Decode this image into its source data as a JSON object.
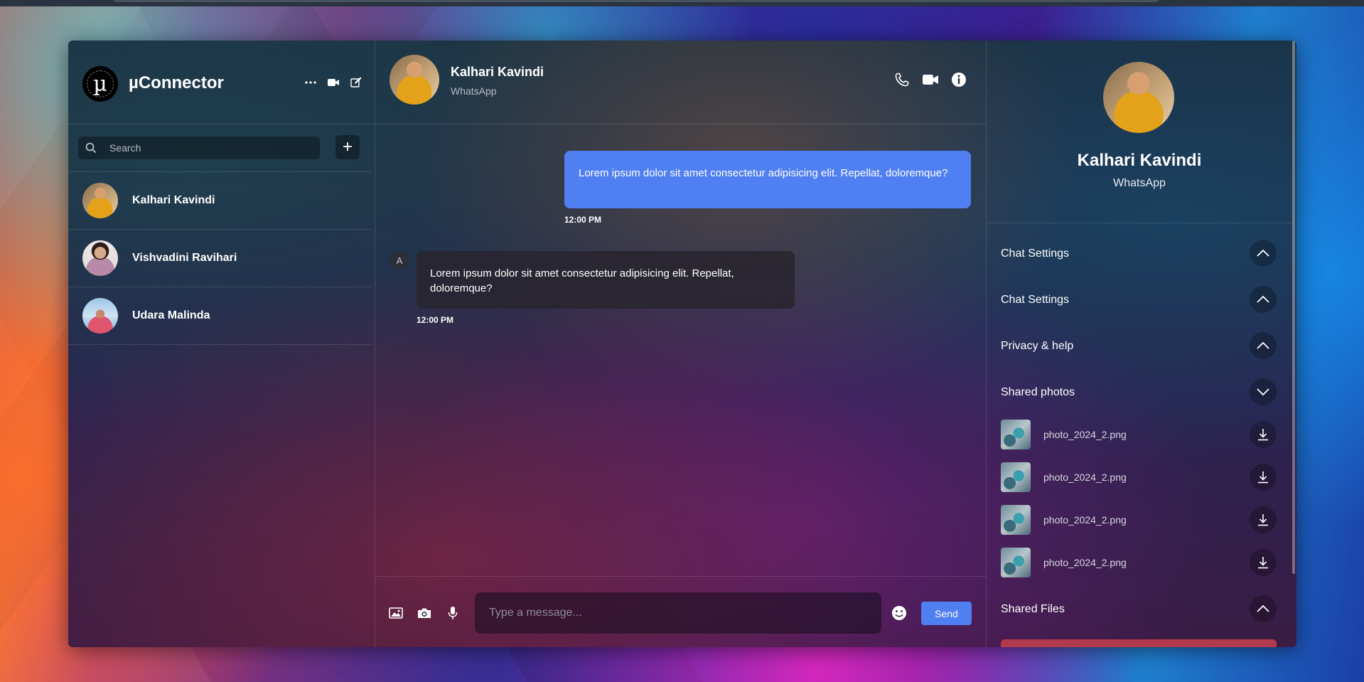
{
  "app": {
    "name": "µConnector",
    "logo_glyph": "µ"
  },
  "colors": {
    "accent": "#4f7ff0",
    "incoming_bubble": "#28242e"
  },
  "sidebar": {
    "search": {
      "placeholder": "Search"
    },
    "add_label": "+",
    "contacts": [
      {
        "name": "Kalhari Kavindi"
      },
      {
        "name": "Vishvadini Ravihari"
      },
      {
        "name": "Udara Malinda"
      }
    ]
  },
  "chat": {
    "contact_name": "Kalhari Kavindi",
    "platform": "WhatsApp",
    "messages": [
      {
        "direction": "out",
        "text": "Lorem ipsum dolor sit amet consectetur adipisicing elit. Repellat, doloremque?",
        "time": "12:00 PM"
      },
      {
        "direction": "in",
        "sender_initial": "A",
        "text": "Lorem ipsum dolor sit amet consectetur adipisicing elit. Repellat, doloremque?",
        "time": "12:00 PM"
      }
    ],
    "composer": {
      "placeholder": "Type a message...",
      "send_label": "Send"
    }
  },
  "info": {
    "name": "Kalhari Kavindi",
    "platform": "WhatsApp",
    "sections": [
      {
        "label": "Chat Settings",
        "state": "collapsed"
      },
      {
        "label": "Chat Settings",
        "state": "collapsed"
      },
      {
        "label": "Privacy & help",
        "state": "collapsed"
      },
      {
        "label": "Shared photos",
        "state": "expanded"
      }
    ],
    "shared_photos": [
      {
        "name": "photo_2024_2.png"
      },
      {
        "name": "photo_2024_2.png"
      },
      {
        "name": "photo_2024_2.png"
      },
      {
        "name": "photo_2024_2.png"
      }
    ],
    "shared_files": {
      "label": "Shared Files",
      "state": "collapsed"
    }
  }
}
